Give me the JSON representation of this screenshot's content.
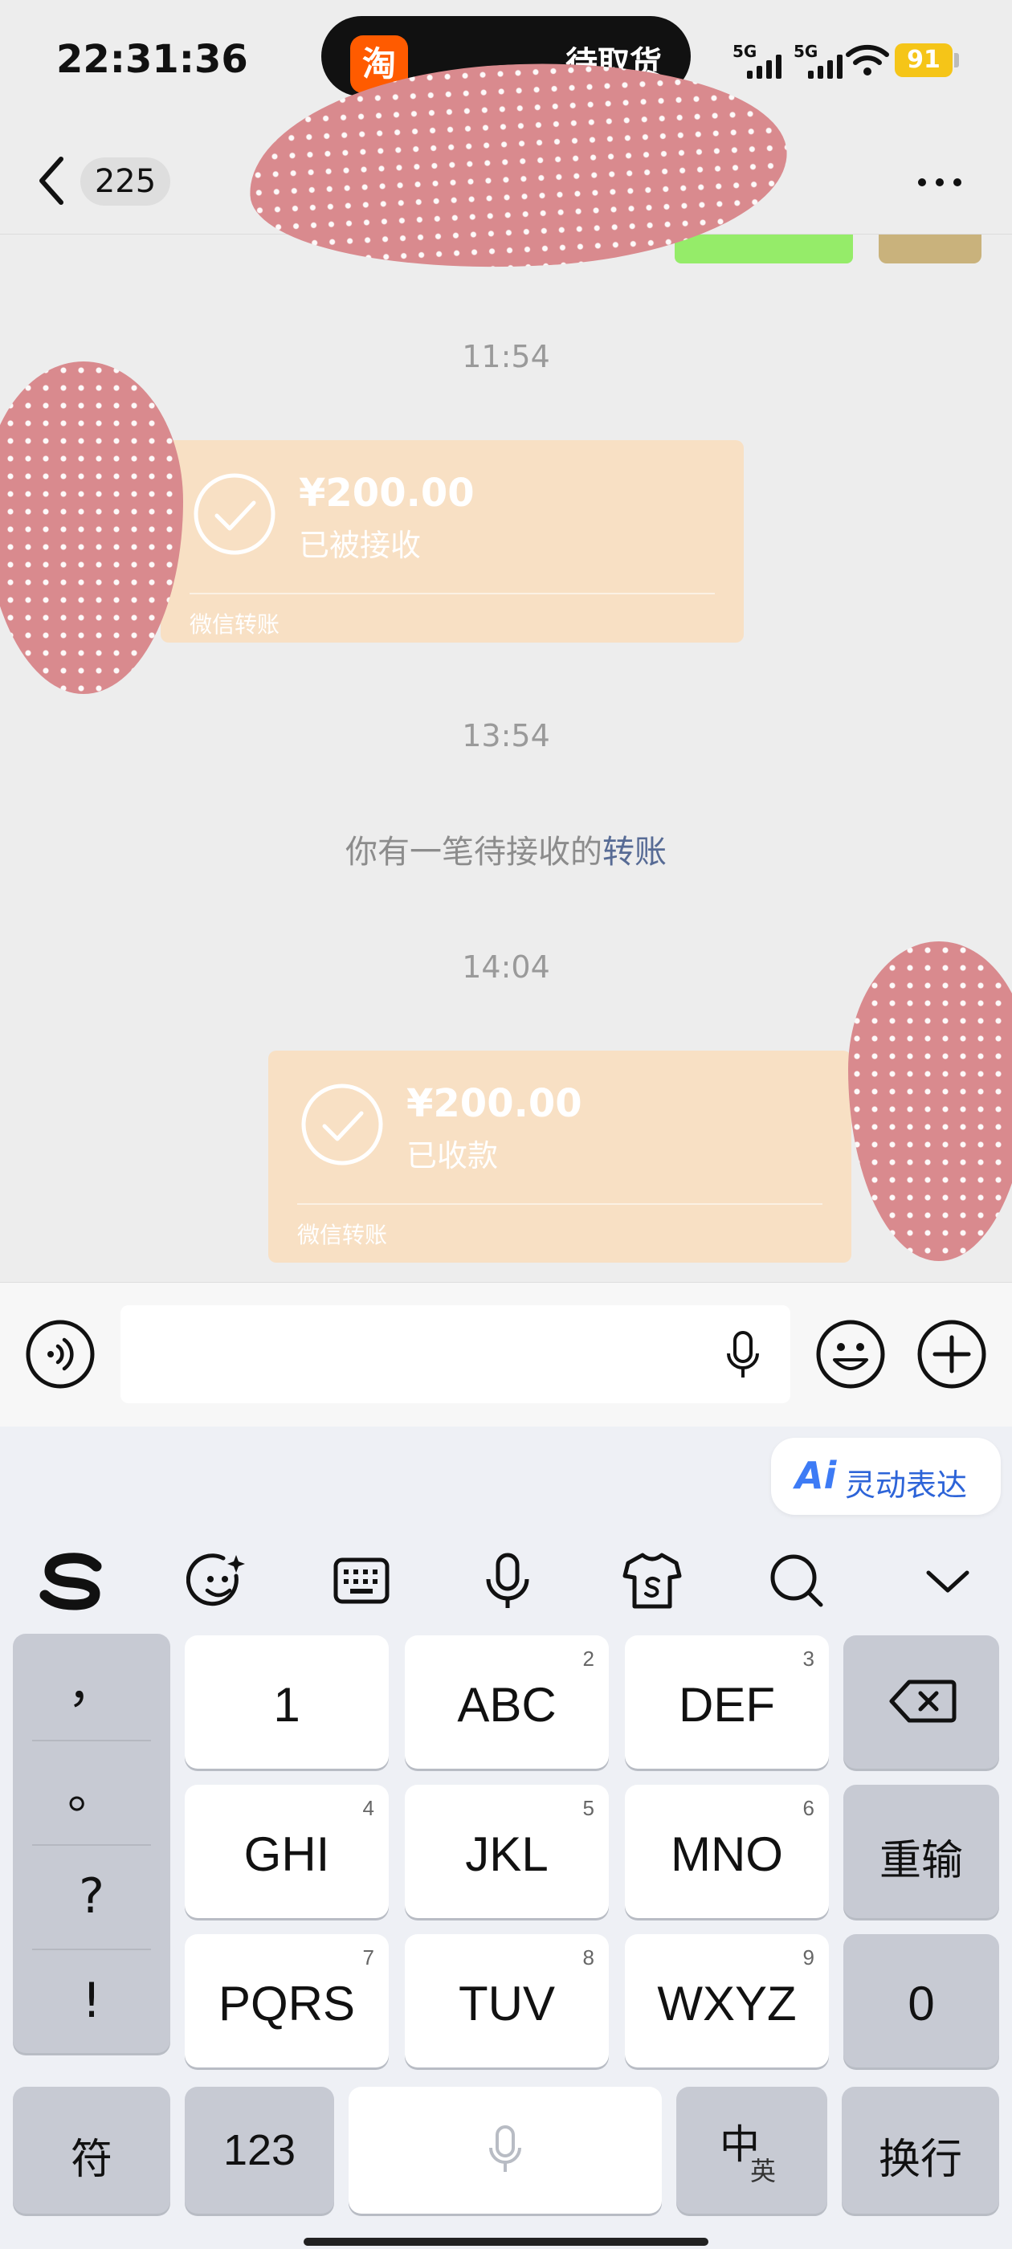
{
  "status_bar": {
    "time": "22:31:36",
    "island_app_glyph": "淘",
    "island_text": "待取货",
    "signal1_label": "5G",
    "signal2_label": "5G",
    "battery": "91",
    "wifi_icon": "wifi-icon"
  },
  "nav": {
    "back_icon": "chevron-left-icon",
    "unread_count": "225",
    "more_icon": "more-dots-icon"
  },
  "chat": {
    "messages": [
      {
        "type": "timestamp",
        "text": "11:54"
      },
      {
        "type": "transfer",
        "direction": "incoming",
        "amount": "¥200.00",
        "status": "已被接收",
        "source": "微信转账"
      },
      {
        "type": "timestamp",
        "text": "13:54"
      },
      {
        "type": "system",
        "text": "你有一笔待接收的",
        "link": "转账"
      },
      {
        "type": "timestamp",
        "text": "14:04"
      },
      {
        "type": "transfer",
        "direction": "outgoing",
        "amount": "¥200.00",
        "status": "已收款",
        "source": "微信转账"
      }
    ]
  },
  "input_bar": {
    "voice_icon": "voice-icon",
    "placeholder": "",
    "mic_icon": "mic-icon",
    "emoji_icon": "emoji-icon",
    "plus_icon": "plus-icon"
  },
  "keyboard": {
    "ai_chip": {
      "logo": "Ai",
      "label": "灵动表达"
    },
    "toolbar_icons": [
      "sogou-logo-icon",
      "emoji-sparkle-icon",
      "keyboard-icon",
      "mic-icon",
      "skin-shirt-icon",
      "search-icon",
      "chevron-down-icon"
    ],
    "punctuation": [
      "，",
      "。",
      "?",
      "!"
    ],
    "keys": [
      {
        "label": "1",
        "num": ""
      },
      {
        "label": "ABC",
        "num": "2"
      },
      {
        "label": "DEF",
        "num": "3"
      },
      {
        "label": "GHI",
        "num": "4"
      },
      {
        "label": "JKL",
        "num": "5"
      },
      {
        "label": "MNO",
        "num": "6"
      },
      {
        "label": "PQRS",
        "num": "7"
      },
      {
        "label": "TUV",
        "num": "8"
      },
      {
        "label": "WXYZ",
        "num": "9"
      }
    ],
    "reinput": "重输",
    "zero": "0",
    "symbols": "符",
    "numbers": "123",
    "lang_main": "中",
    "lang_sub": "英",
    "newline": "换行",
    "accent_color": "#2d64d8"
  },
  "colors": {
    "transfer_bg": "#f8e0c4",
    "link": "#576b95",
    "background": "#ededed"
  }
}
